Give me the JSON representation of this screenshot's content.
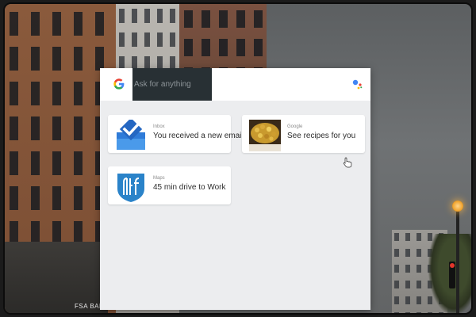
{
  "search": {
    "placeholder": "Ask for anything"
  },
  "icons": {
    "google": "google-g-icon",
    "assistant": "assistant-dots-icon",
    "inbox": "inbox-app-icon",
    "maps": "maps-route-icon",
    "cursor": "hand-pointer-icon"
  },
  "cards": [
    {
      "source": "Inbox",
      "title": "You received a new email"
    },
    {
      "source": "Google",
      "title": "See recipes for you"
    },
    {
      "source": "Maps",
      "title": "45 min drive to Work"
    }
  ],
  "colors": {
    "panel_bg": "#ecedef",
    "search_bg": "#283034",
    "inbox_blue": "#2f7bd8",
    "maps_blue": "#2a83c9"
  },
  "background": {
    "sign_text": "FSA BANK"
  }
}
